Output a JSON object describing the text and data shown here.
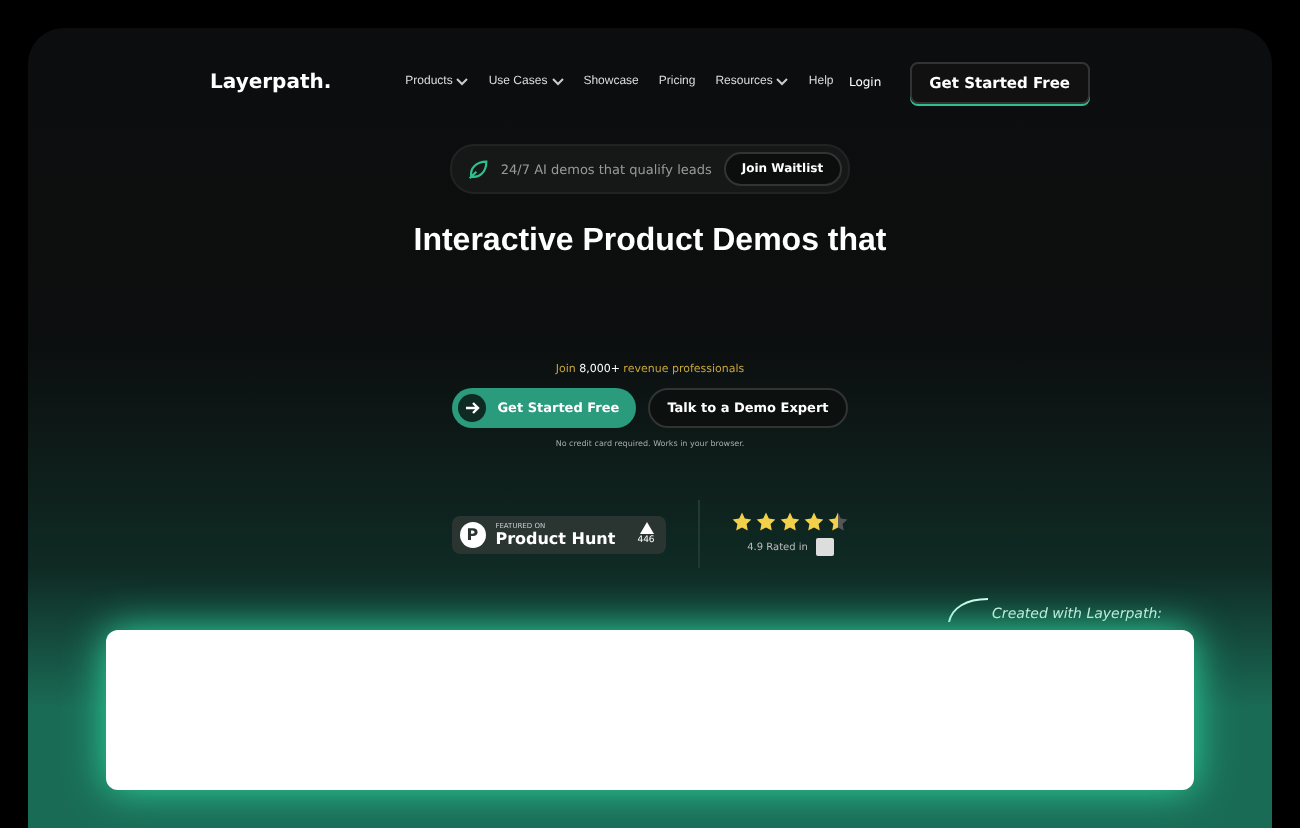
{
  "nav": {
    "logo": "Layerpath.",
    "links": [
      {
        "label": "Products",
        "dropdown": true
      },
      {
        "label": "Use Cases",
        "dropdown": true
      },
      {
        "label": "Showcase",
        "dropdown": false
      },
      {
        "label": "Pricing",
        "dropdown": false
      },
      {
        "label": "Resources",
        "dropdown": true
      },
      {
        "label": "Help",
        "dropdown": false
      }
    ],
    "login": "Login",
    "cta": "Get Started Free"
  },
  "announcement": {
    "text": "24/7 AI demos that qualify leads",
    "button": "Join Waitlist"
  },
  "hero": {
    "title": "Interactive Product Demos that",
    "social_proof": "Join **8,000+** revenue professionals",
    "primary_button": "Get Started Free",
    "secondary_button": "Talk to a Demo Expert",
    "note": "No credit card required. Works in your browser."
  },
  "badges": {
    "product_hunt": {
      "logo": "P",
      "featured": "FEATURED ON",
      "name": "Product Hunt",
      "upvotes": "446"
    },
    "rating": {
      "stars": 4.5,
      "text": "4.9 Rated in"
    }
  },
  "demo": {
    "caption": "Created with Layerpath:"
  }
}
